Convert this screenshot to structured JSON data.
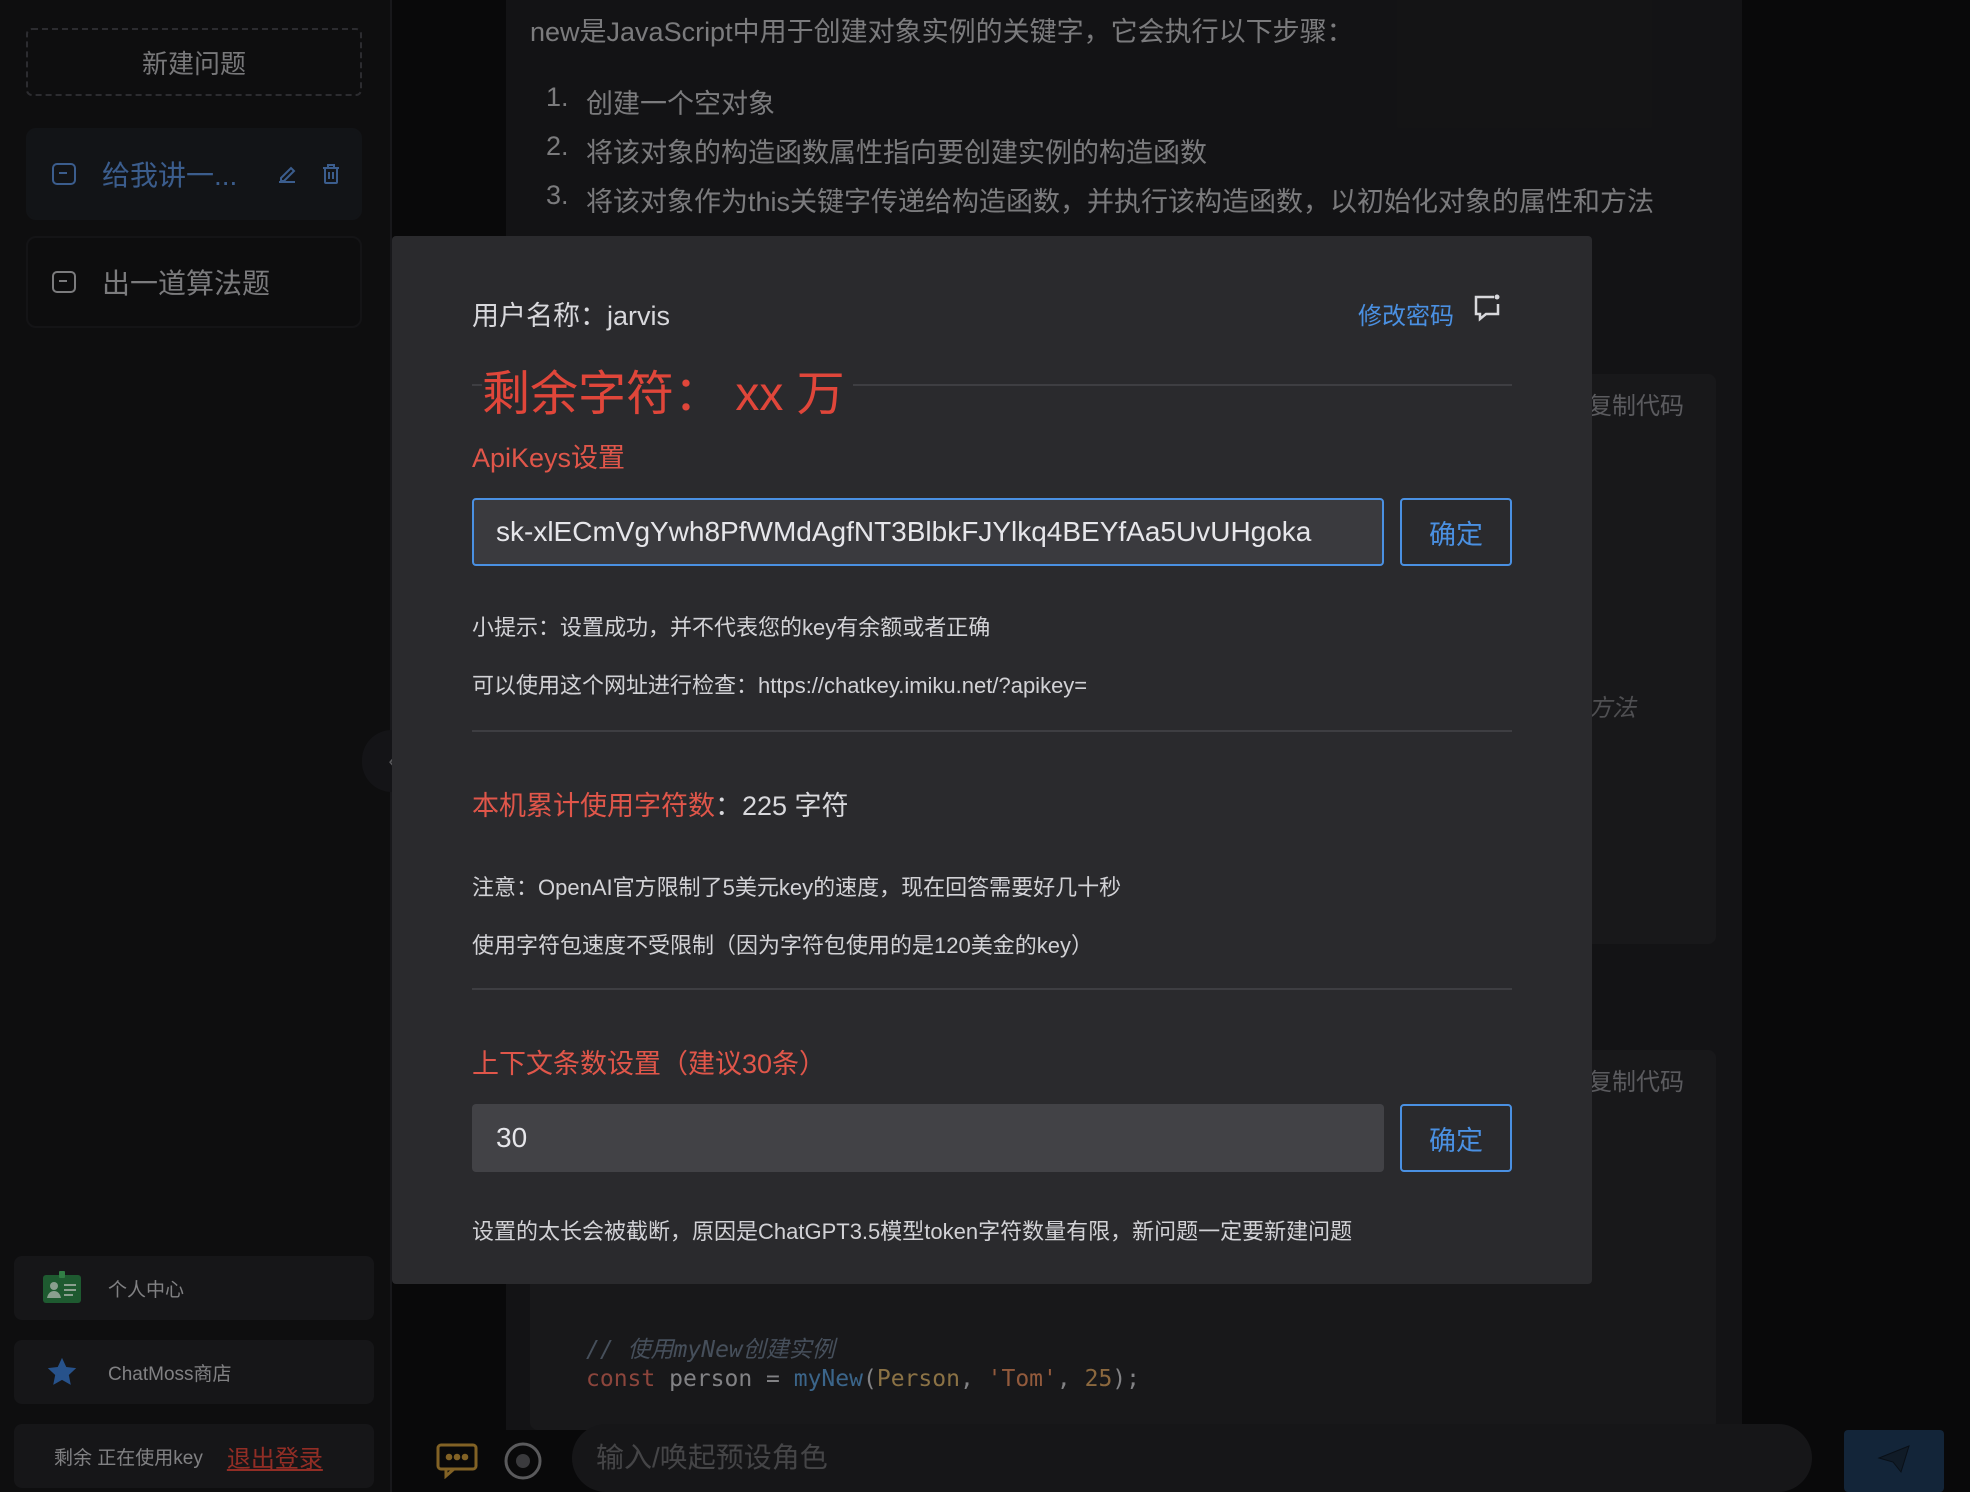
{
  "sidebar": {
    "new_question": "新建问题",
    "chats": [
      {
        "label": "给我讲一..."
      },
      {
        "label": "出一道算法题"
      }
    ],
    "bottom": {
      "profile": "个人中心",
      "store": "ChatMoss商店",
      "status": "剩余 正在使用key",
      "logout": "退出登录"
    }
  },
  "main": {
    "intro": "new是JavaScript中用于创建对象实例的关键字，它会执行以下步骤：",
    "steps": [
      {
        "num": "1.",
        "text": "创建一个空对象"
      },
      {
        "num": "2.",
        "text": "将该对象的构造函数属性指向要创建实例的构造函数"
      },
      {
        "num": "3.",
        "text": "将该对象作为this关键字传递给构造函数，并执行该构造函数，以初始化对象的属性和方法"
      }
    ],
    "copy_code": "复制代码",
    "partial_text": "方法",
    "code": {
      "comment": "// 使用myNew创建实例",
      "kw": "const",
      "var": " person = ",
      "fn": "myNew",
      "paren_open": "(",
      "cls": "Person",
      "comma1": ", ",
      "str": "'Tom'",
      "comma2": ", ",
      "num": "25",
      "end": ");"
    },
    "input_placeholder": "输入/唤起预设角色"
  },
  "modal": {
    "username_label": "用户名称：",
    "username": "jarvis",
    "change_password": "修改密码",
    "remaining": "剩余字符： xx 万",
    "apikeys_title": "ApiKeys设置",
    "apikey_value": "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",
    "confirm": "确定",
    "tip1": "小提示：设置成功，并不代表您的key有余额或者正确",
    "tip2": "可以使用这个网址进行检查：https://chatkey.imiku.net/?apikey=",
    "usage_label": "本机累计使用字符数",
    "usage_value": "：225 字符",
    "notice1": "注意：OpenAI官方限制了5美元key的速度，现在回答需要好几十秒",
    "notice2": "使用字符包速度不受限制（因为字符包使用的是120美金的key）",
    "context_title": "上下文条数设置（建议30条）",
    "context_value": "30",
    "context_note": "设置的太长会被截断，原因是ChatGPT3.5模型token字符数量有限，新问题一定要新建问题"
  },
  "colors": {
    "accent_blue": "#4a90e2",
    "warning_red": "#e0463a",
    "modal_bg": "#2a2a2d",
    "page_bg": "#0e0e10"
  },
  "icons": [
    "chat-bubble-icon",
    "edit-icon",
    "trash-icon",
    "id-card-icon",
    "star-icon",
    "chevron-left-icon",
    "feedback-icon",
    "message-icon",
    "record-icon",
    "send-icon"
  ]
}
